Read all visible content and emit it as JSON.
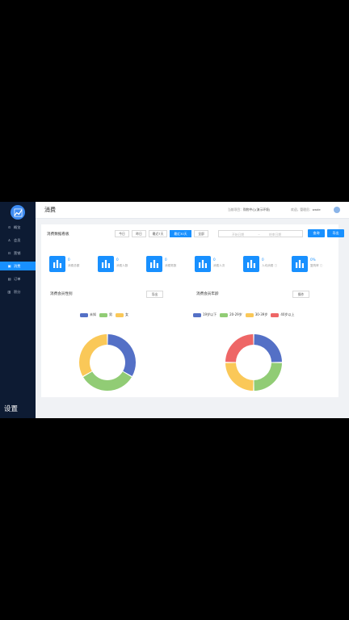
{
  "sidebar": {
    "items": [
      {
        "label": "概览",
        "icon": "dashboard-icon",
        "glyph": "⊙",
        "active": false
      },
      {
        "label": "会员",
        "icon": "user-icon",
        "glyph": "♙",
        "active": false
      },
      {
        "label": "营销",
        "icon": "marketing-icon",
        "glyph": "⊡",
        "active": false
      },
      {
        "label": "消费",
        "icon": "consume-icon",
        "glyph": "▣",
        "active": true
      },
      {
        "label": "订单",
        "icon": "order-icon",
        "glyph": "▤",
        "active": false
      },
      {
        "label": "积分",
        "icon": "points-icon",
        "glyph": "▥",
        "active": false
      }
    ],
    "settings_label": "设置"
  },
  "header": {
    "title": "消费",
    "project_label": "当前项目：",
    "project_value": "购物中心(演示环境)",
    "welcome_label": "欢迎，管理员：",
    "username": "wade"
  },
  "filters": {
    "section_title": "消费数据看板",
    "options": [
      "今日",
      "昨日",
      "最近7天",
      "最近30天",
      "全部"
    ],
    "active_index": 3,
    "start_placeholder": "开始日期",
    "separator": "~",
    "end_placeholder": "结束日期",
    "query_label": "查询",
    "export_label": "导出"
  },
  "stats": [
    {
      "value": "0",
      "label": "消费总额"
    },
    {
      "value": "0",
      "label": "消费人数"
    },
    {
      "value": "0",
      "label": "消费笔数"
    },
    {
      "value": "0",
      "label": "消费人次"
    },
    {
      "value": "0",
      "label": "人均消费 ⓘ"
    },
    {
      "value": "0%",
      "label": "复购率 ⓘ"
    }
  ],
  "gender_chart": {
    "title": "消费会员性别",
    "export_label": "导出",
    "legend": [
      {
        "name": "未知",
        "color": "#5470c6"
      },
      {
        "name": "男",
        "color": "#91cc75"
      },
      {
        "name": "女",
        "color": "#fac858"
      }
    ]
  },
  "age_chart": {
    "title": "消费会员年龄",
    "export_label": "操作",
    "legend": [
      {
        "name": "19岁以下",
        "color": "#5470c6"
      },
      {
        "name": "20-29岁",
        "color": "#91cc75"
      },
      {
        "name": "30-39岁",
        "color": "#fac858"
      },
      {
        "name": "40岁以上",
        "color": "#ee6666"
      }
    ]
  },
  "chart_data": [
    {
      "type": "pie",
      "title": "消费会员性别",
      "categories": [
        "未知",
        "男",
        "女"
      ],
      "values": [
        1,
        1,
        1
      ],
      "colors": [
        "#5470c6",
        "#91cc75",
        "#fac858"
      ],
      "legend": "top-center"
    },
    {
      "type": "pie",
      "title": "消费会员年龄",
      "categories": [
        "19岁以下",
        "20-29岁",
        "30-39岁",
        "40岁以上"
      ],
      "values": [
        1,
        1,
        1,
        1
      ],
      "colors": [
        "#5470c6",
        "#91cc75",
        "#fac858",
        "#ee6666"
      ],
      "legend": "top-center"
    }
  ]
}
